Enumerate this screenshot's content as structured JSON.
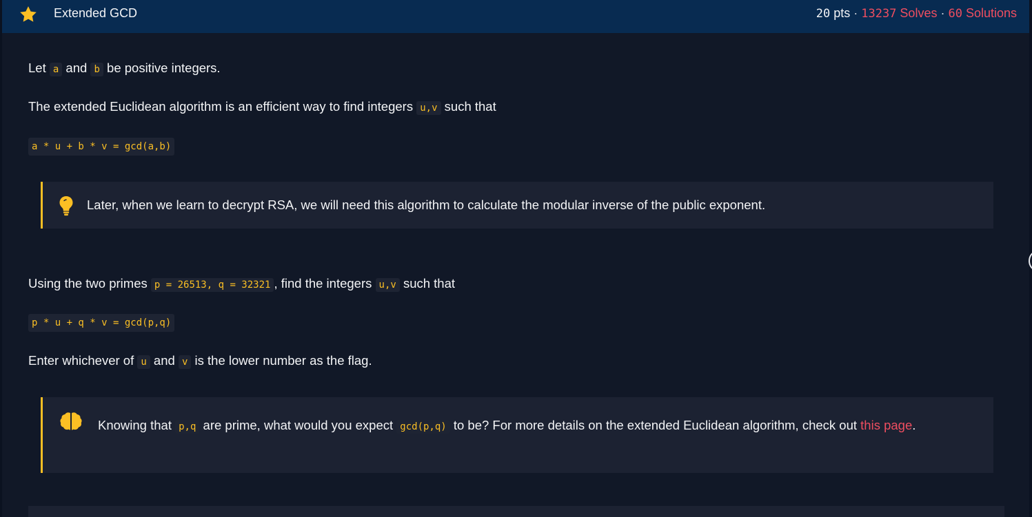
{
  "header": {
    "title": "Extended GCD",
    "points_value": "20",
    "points_unit": " pts",
    "separator": "·",
    "solves_count": "13237",
    "solves_label": " Solves",
    "solutions_count": "60",
    "solutions_label": " Solutions",
    "star_color": "#fbbf24",
    "accent_color": "#ef4e60"
  },
  "body": {
    "p1": {
      "t1": "Let ",
      "c1": "a",
      "t2": " and ",
      "c2": "b",
      "t3": " be positive integers."
    },
    "p2": {
      "t1": "The extended Euclidean algorithm is an efficient way to find integers ",
      "c1": "u,v",
      "t2": " such that"
    },
    "code1": "a * u + b * v = gcd(a,b)",
    "callout1": {
      "icon": "lightbulb-icon",
      "text": "Later, when we learn to decrypt RSA, we will need this algorithm to calculate the modular inverse of the public exponent."
    },
    "p3": {
      "t1": "Using the two primes ",
      "c1": "p = 26513, q = 32321",
      "t2": ", find the integers ",
      "c2": "u,v",
      "t3": " such that"
    },
    "code2": "p * u + q * v = gcd(p,q)",
    "p4": {
      "t1": "Enter whichever of ",
      "c1": "u",
      "t2": " and ",
      "c2": "v",
      "t3": " is the lower number as the flag."
    },
    "callout2": {
      "icon": "brain-icon",
      "t1": "Knowing that ",
      "c1": "p,q",
      "t2": " are prime, what would you expect ",
      "c2": "gcd(p,q)",
      "t3": " to be? For more details on the extended Euclidean algorithm, check out ",
      "link1": "this",
      "link2": "page",
      "t4": "."
    }
  }
}
